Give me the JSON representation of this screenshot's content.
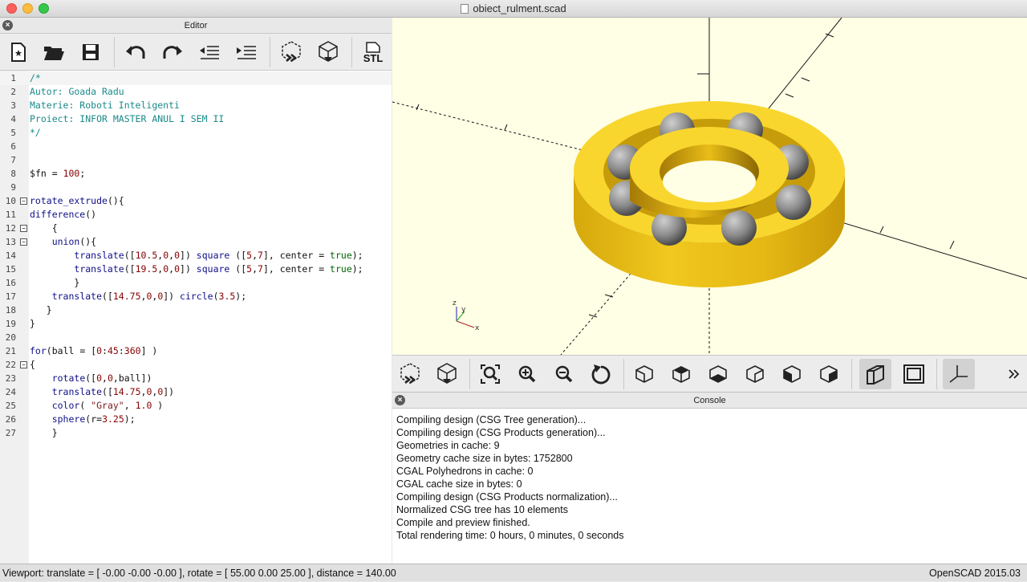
{
  "window": {
    "title": "obiect_rulment.scad"
  },
  "editor": {
    "header": "Editor",
    "toolbar": {
      "icons": [
        "new-file-icon",
        "open-folder-icon",
        "save-icon",
        "undo-icon",
        "redo-icon",
        "unindent-icon",
        "indent-icon",
        "preview-icon",
        "render-icon",
        "export-stl-icon"
      ],
      "stl_label": "STL"
    },
    "lines": [
      "/*",
      "Autor: Goada Radu",
      "Materie: Roboti Inteligenti",
      "Proiect: INFOR MASTER ANUL I SEM II",
      "*/",
      "",
      "",
      "$fn = 100;",
      "",
      "rotate_extrude(){",
      "difference()",
      "    {",
      "    union(){",
      "        translate([10.5,0,0]) square ([5,7], center = true);",
      "        translate([19.5,0,0]) square ([5,7], center = true);",
      "        }",
      "    translate([14.75,0,0]) circle(3.5);",
      "   }",
      "}",
      "",
      "for(ball = [0:45:360] )",
      "{",
      "    rotate([0,0,ball])",
      "    translate([14.75,0,0])",
      "    color( \"Gray\", 1.0 )",
      "    sphere(r=3.25);",
      "    }"
    ]
  },
  "viewport": {
    "background": "#ffffe5",
    "model_color": "#f5d328",
    "ball_color": "#8a8a8a",
    "axis_labels": {
      "x": "x",
      "y": "y",
      "z": "z"
    }
  },
  "view_toolbar": {
    "icons": [
      "preview-icon",
      "render-icon",
      "zoom-all-icon",
      "zoom-in-icon",
      "zoom-out-icon",
      "reset-view-icon",
      "view-right-icon",
      "view-top-icon",
      "view-bottom-icon",
      "view-left-icon",
      "view-front-icon",
      "view-back-icon",
      "perspective-icon",
      "orthogonal-icon",
      "show-axes-icon",
      "more-icon"
    ]
  },
  "console": {
    "header": "Console",
    "lines": [
      "Compiling design (CSG Tree generation)...",
      "Compiling design (CSG Products generation)...",
      "Geometries in cache: 9",
      "Geometry cache size in bytes: 1752800",
      "CGAL Polyhedrons in cache: 0",
      "CGAL cache size in bytes: 0",
      "Compiling design (CSG Products normalization)...",
      "Normalized CSG tree has 10 elements",
      "Compile and preview finished.",
      "Total rendering time: 0 hours, 0 minutes, 0 seconds"
    ]
  },
  "status": {
    "viewport": "Viewport: translate = [ -0.00 -0.00 -0.00 ], rotate = [ 55.00 0.00 25.00 ], distance = 140.00",
    "version": "OpenSCAD 2015.03"
  }
}
